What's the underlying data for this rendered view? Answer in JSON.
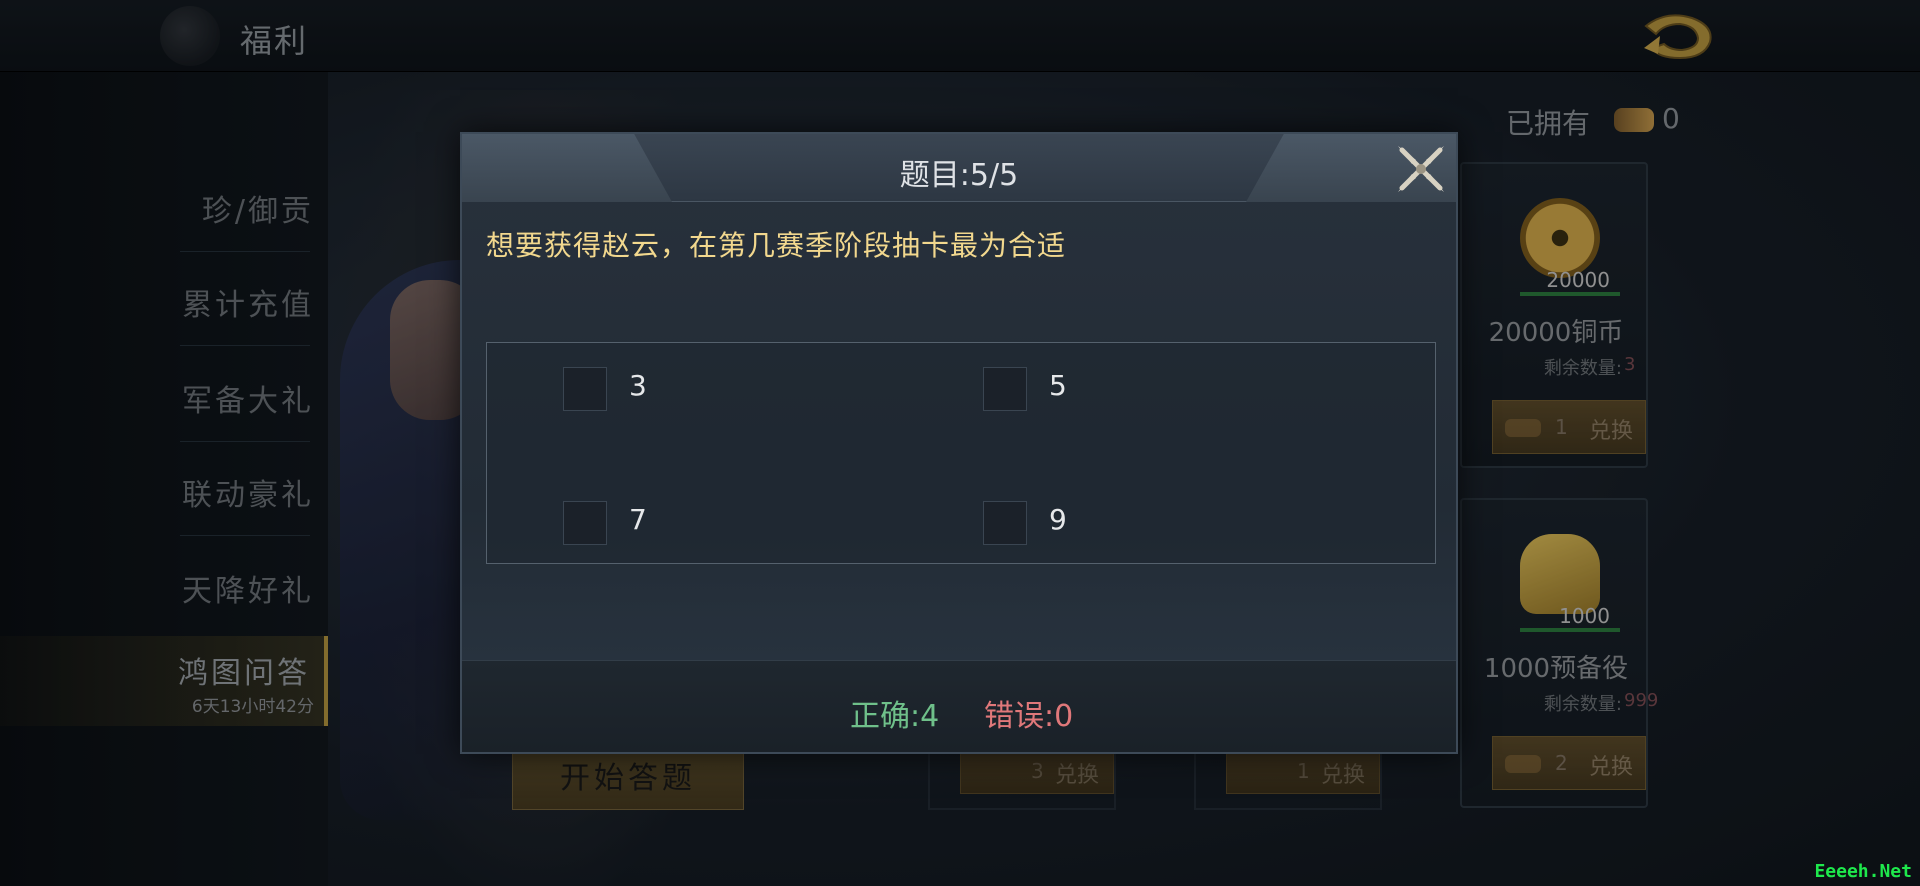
{
  "header": {
    "title": "福利"
  },
  "nav": {
    "items": [
      {
        "label": "珍/御贡"
      },
      {
        "label": "累计充值"
      },
      {
        "label": "军备大礼"
      },
      {
        "label": "联动豪礼"
      },
      {
        "label": "天降好礼"
      },
      {
        "label": "鸿图问答",
        "sublabel": "6天13小时42分",
        "active": true
      }
    ]
  },
  "wallet": {
    "owned_label": "已拥有",
    "owned_count": "0"
  },
  "shop": {
    "cards": [
      {
        "amount": "20000",
        "name": "20000铜币",
        "remain_label": "剩余数量:",
        "remain_value": "3",
        "cost": "1",
        "exchange_label": "兑换",
        "icon": "copper-coin-icon"
      },
      {
        "amount": "1000",
        "name": "1000预备役",
        "remain_label": "剩余数量:",
        "remain_value": "999",
        "cost": "2",
        "exchange_label": "兑换",
        "icon": "helmet-icon"
      }
    ],
    "bottom_exchanges": [
      {
        "cost": "3",
        "label": "兑换"
      },
      {
        "cost": "1",
        "label": "兑换"
      }
    ]
  },
  "start_button": {
    "label": "开始答题"
  },
  "quiz": {
    "title": "题目:5/5",
    "question": "想要获得赵云，在第几赛季阶段抽卡最为合适",
    "options": [
      "3",
      "5",
      "7",
      "9"
    ],
    "correct_text": "正确:4",
    "wrong_text": "错误:0"
  },
  "watermark": "Eeeeh.Net",
  "colors": {
    "question": "#f2d88e",
    "correct": "#6fc08a",
    "wrong": "#e0787a",
    "accent_gold": "#b5963f"
  }
}
